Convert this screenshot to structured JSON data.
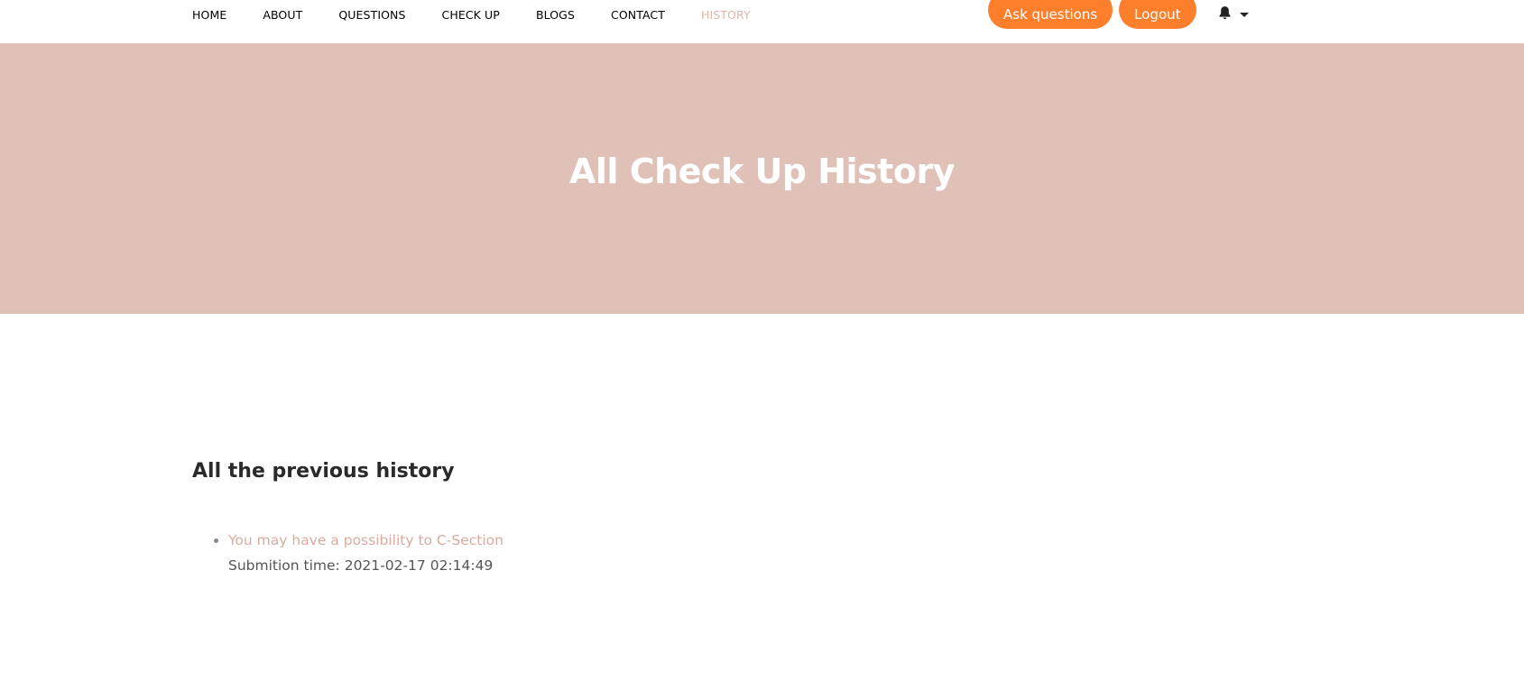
{
  "nav": {
    "links": [
      {
        "label": "HOME"
      },
      {
        "label": "ABOUT"
      },
      {
        "label": "QUESTIONS"
      },
      {
        "label": "CHECK UP"
      },
      {
        "label": "BLOGS"
      },
      {
        "label": "CONTACT"
      },
      {
        "label": "HISTORY"
      }
    ],
    "ask_button": "Ask questions",
    "logout_button": "Logout",
    "icons": {
      "bell": "bell-icon",
      "caret": "caret-down-icon"
    }
  },
  "hero": {
    "title": "All Check Up History"
  },
  "main": {
    "heading": "All the previous history",
    "history": [
      {
        "result": "You may have a possibility to C-Section",
        "submission_label": "Submition time: ",
        "submission_time": "2021-02-17 02:14:49"
      }
    ]
  },
  "colors": {
    "accent": "#fd7e2b",
    "hero_bg": "#dfc1b8",
    "active_link": "#e0b6ab",
    "result_link": "#d9ab9f"
  }
}
